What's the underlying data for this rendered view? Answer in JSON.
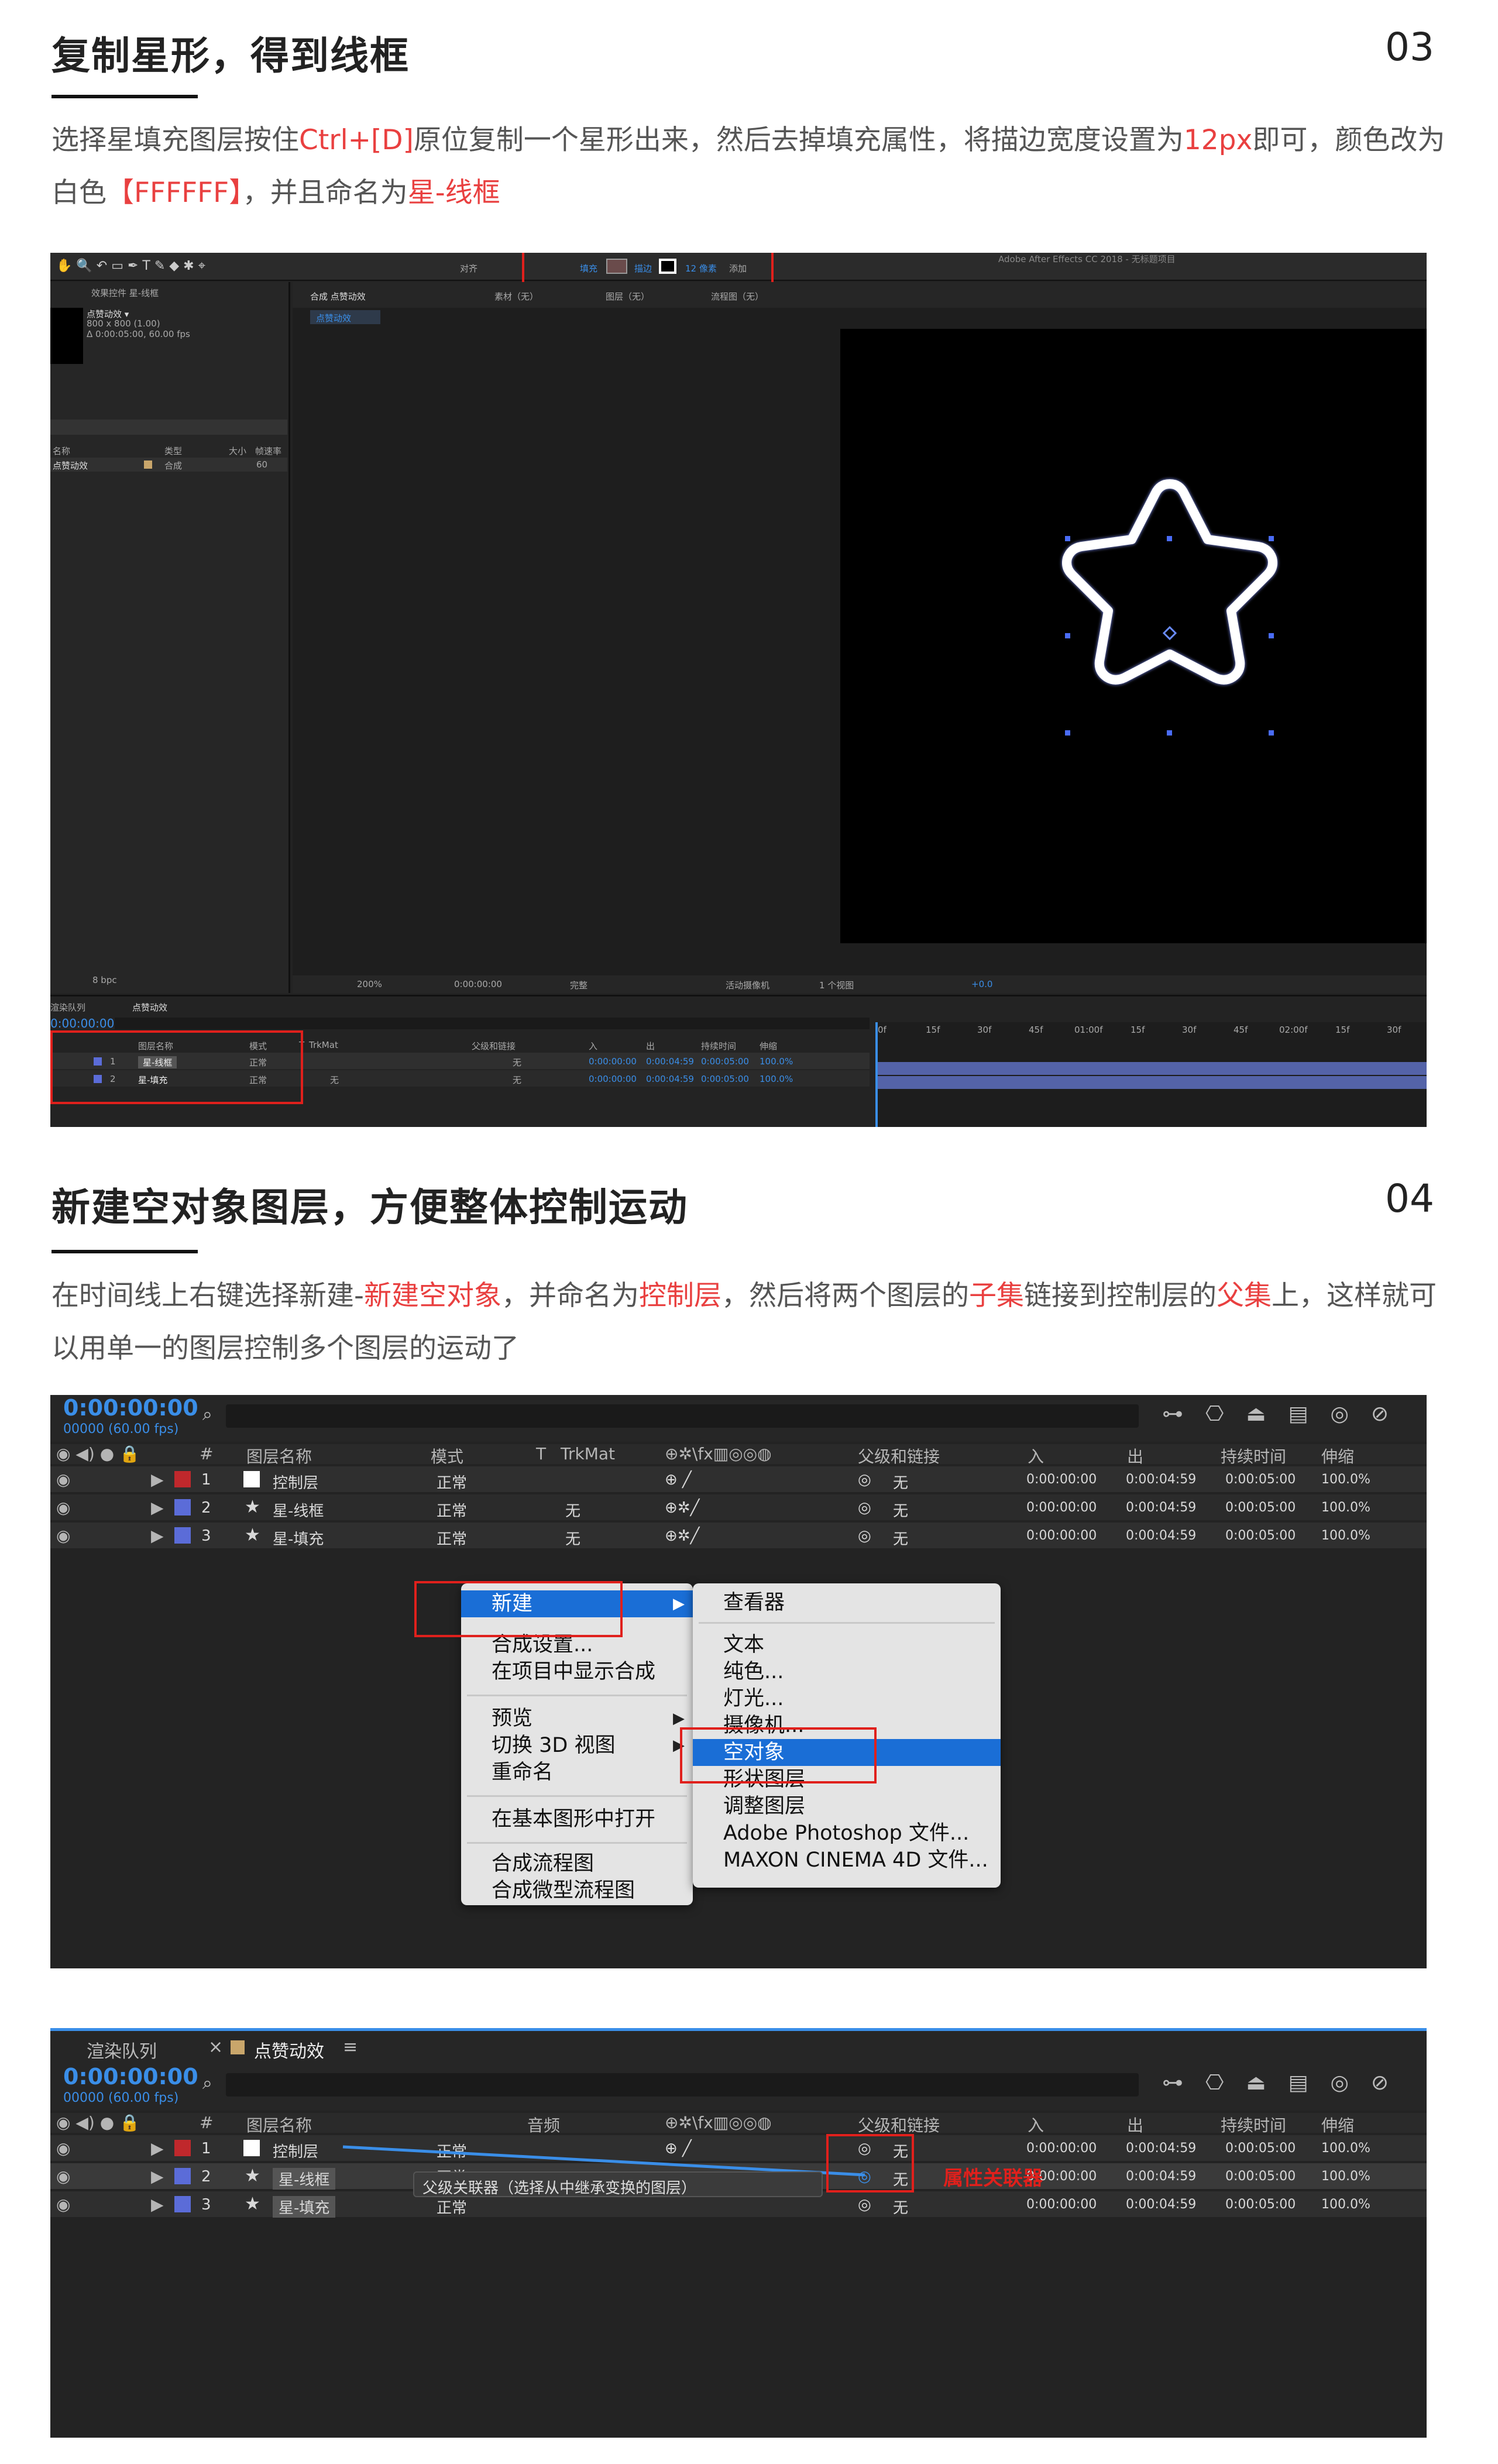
{
  "section3": {
    "title": "复制星形，得到线框",
    "number": "03",
    "para": [
      "选择星填充图层按住",
      "Ctrl+[D]",
      "原位复制一个星形出来，然后去掉填充属性，将描边宽度设置为",
      "12px",
      "即可，颜色改为白色",
      "【FFFFFF】",
      "，并且命名为",
      "星-线框"
    ]
  },
  "shot1": {
    "window_title": "Adobe After Effects CC 2018 - 无标题项目",
    "toolbar": {
      "align": "对齐",
      "fill": "填充",
      "stroke": "描边",
      "stroke_width": "12 像素",
      "add": "添加"
    },
    "project_panel": {
      "title": "效果控件 星-线框",
      "comp_name": "点赞动效 ▾",
      "comp_size": "800 x 800 (1.00)",
      "comp_duration": "Δ 0:00:05:00, 60.00 fps",
      "col_name": "名称",
      "col_type": "类型",
      "col_size": "大小",
      "col_fps": "帧速率",
      "item_name": "点赞动效",
      "item_type": "合成",
      "item_fps": "60",
      "bpc": "8 bpc"
    },
    "comp_tabs": {
      "comp": "合成 点赞动效",
      "footage": "素材（无）",
      "layer": "图层（无）",
      "flow": "流程图（无）",
      "sub": "点赞动效"
    },
    "viewer_bar": {
      "zoom": "200%",
      "time": "0:00:00:00",
      "quality": "完整",
      "camera": "活动摄像机",
      "views": "1 个视图",
      "exposure": "+0.0"
    },
    "timeline": {
      "tab_render": "渲染队列",
      "tab_comp": "点赞动效",
      "time": "0:00:00:00",
      "cols": {
        "name": "图层名称",
        "mode": "模式",
        "t": "T",
        "trkmat": "TrkMat",
        "parent": "父级和链接",
        "in": "入",
        "out": "出",
        "duration": "持续时间",
        "stretch": "伸缩"
      },
      "rows": [
        {
          "num": "1",
          "name": "星-线框",
          "mode": "正常",
          "trk": "",
          "parent": "无",
          "in": "0:00:00:00",
          "out": "0:00:04:59",
          "dur": "0:00:05:00",
          "stretch": "100.0%"
        },
        {
          "num": "2",
          "name": "星-填充",
          "mode": "正常",
          "trk": "无",
          "parent": "无",
          "in": "0:00:00:00",
          "out": "0:00:04:59",
          "dur": "0:00:05:00",
          "stretch": "100.0%"
        }
      ],
      "ruler": [
        "0f",
        "15f",
        "30f",
        "45f",
        "01:00f",
        "15f",
        "30f",
        "45f",
        "02:00f",
        "15f",
        "30f"
      ]
    }
  },
  "section4": {
    "title": "新建空对象图层，方便整体控制运动",
    "number": "04",
    "para": [
      "在时间线上右键选择新建-",
      "新建空对象",
      "，并命名为",
      "控制层",
      "，然后将两个图层的",
      "子集",
      "链接到控制层的",
      "父集",
      "上，这样就可以用单一的图层控制多个图层的运动了"
    ]
  },
  "shot2": {
    "time": "0:00:00:00",
    "fps": "00000 (60.00 fps)",
    "cols": {
      "num": "#",
      "name": "图层名称",
      "mode": "模式",
      "t": "T",
      "trkmat": "TrkMat",
      "parent": "父级和链接",
      "in": "入",
      "out": "出",
      "duration": "持续时间",
      "stretch": "伸缩"
    },
    "rows": [
      {
        "num": "1",
        "name": "控制层",
        "mode": "正常",
        "trk": "",
        "parent": "无",
        "in": "0:00:00:00",
        "out": "0:00:04:59",
        "dur": "0:00:05:00",
        "stretch": "100.0%",
        "color": "#c0282c"
      },
      {
        "num": "2",
        "name": "星-线框",
        "mode": "正常",
        "trk": "无",
        "parent": "无",
        "in": "0:00:00:00",
        "out": "0:00:04:59",
        "dur": "0:00:05:00",
        "stretch": "100.0%",
        "color": "#5b6cd8"
      },
      {
        "num": "3",
        "name": "星-填充",
        "mode": "正常",
        "trk": "无",
        "parent": "无",
        "in": "0:00:00:00",
        "out": "0:00:04:59",
        "dur": "0:00:05:00",
        "stretch": "100.0%",
        "color": "#5b6cd8"
      }
    ],
    "context_menu": [
      "新建",
      "合成设置...",
      "在项目中显示合成",
      "预览",
      "切换 3D 视图",
      "重命名",
      "在基本图形中打开",
      "合成流程图",
      "合成微型流程图"
    ],
    "submenu": [
      "查看器",
      "文本",
      "纯色...",
      "灯光...",
      "摄像机...",
      "空对象",
      "形状图层",
      "调整图层",
      "Adobe Photoshop 文件...",
      "MAXON CINEMA 4D 文件..."
    ]
  },
  "shot3": {
    "tab_render": "渲染队列",
    "tab_comp": "点赞动效",
    "time": "0:00:00:00",
    "fps": "00000 (60.00 fps)",
    "cols": {
      "num": "#",
      "name": "图层名称",
      "audio": "音频",
      "parent": "父级和链接",
      "in": "入",
      "out": "出",
      "duration": "持续时间",
      "stretch": "伸缩"
    },
    "rows": [
      {
        "num": "1",
        "name": "控制层",
        "mode": "正常",
        "parent": "无",
        "in": "0:00:00:00",
        "out": "0:00:04:59",
        "dur": "0:00:05:00",
        "stretch": "100.0%",
        "color": "#c0282c"
      },
      {
        "num": "2",
        "name": "星-线框",
        "mode": "正常",
        "parent": "无",
        "in": "0:00:00:00",
        "out": "0:00:04:59",
        "dur": "0:00:05:00",
        "stretch": "100.0%",
        "color": "#5b6cd8"
      },
      {
        "num": "3",
        "name": "星-填充",
        "mode": "正常",
        "parent": "无",
        "in": "0:00:00:00",
        "out": "0:00:04:59",
        "dur": "0:00:05:00",
        "stretch": "100.0%",
        "color": "#5b6cd8"
      }
    ],
    "tooltip": "父级关联器（选择从中继承变换的图层）",
    "annotation": "属性关联器"
  },
  "colors": {
    "highlight": "#e94040",
    "red_box": "#e0201c",
    "ae_blue": "#3a8ee8",
    "menu_selected": "#1a6ed6"
  }
}
